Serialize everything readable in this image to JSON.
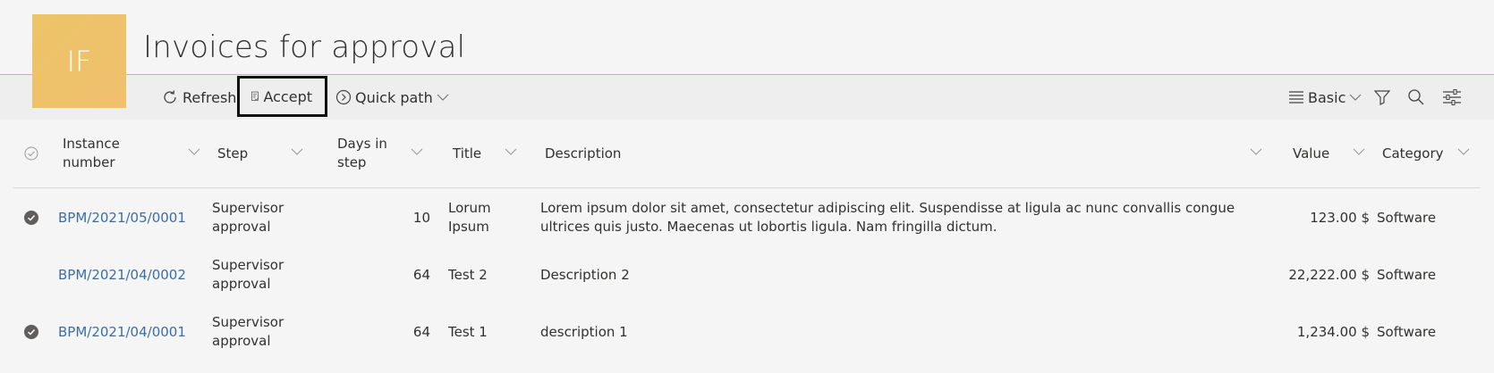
{
  "app": {
    "avatar_initials": "IF",
    "title": "Invoices for approval",
    "accent_color": "#e8b85e"
  },
  "toolbar": {
    "refresh_label": "Refresh",
    "accept_label": "Accept",
    "quick_path_label": "Quick path",
    "view_label": "Basic",
    "icons": [
      "filter-icon",
      "search-icon",
      "settings-icon"
    ]
  },
  "table": {
    "columns": {
      "instance": "Instance number",
      "step": "Step",
      "days": "Days in step",
      "title": "Title",
      "description": "Description",
      "value": "Value",
      "category": "Category"
    },
    "rows": [
      {
        "selected": true,
        "instance": "BPM/2021/05/0001",
        "step": "Supervisor approval",
        "days": "10",
        "title": "Lorum Ipsum",
        "description": "Lorem ipsum dolor sit amet, consectetur adipiscing elit. Suspendisse at ligula ac nunc convallis congue ultrices quis justo. Maecenas ut lobortis ligula. Nam fringilla dictum.",
        "value": "123.00 $",
        "category": "Software"
      },
      {
        "selected": false,
        "instance": "BPM/2021/04/0002",
        "step": "Supervisor approval",
        "days": "64",
        "title": "Test 2",
        "description": "Description 2",
        "value": "22,222.00 $",
        "category": "Software"
      },
      {
        "selected": true,
        "instance": "BPM/2021/04/0001",
        "step": "Supervisor approval",
        "days": "64",
        "title": "Test 1",
        "description": "description 1",
        "value": "1,234.00 $",
        "category": "Software"
      }
    ]
  }
}
